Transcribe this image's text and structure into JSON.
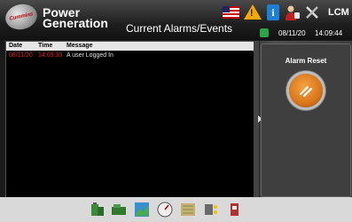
{
  "header": {
    "brand_line1": "Power",
    "brand_line2": "Generation",
    "logo_text": "Cummins",
    "page_title": "Current Alarms/Events",
    "device": "LCM",
    "date": "08/11/20",
    "time": "14:09:44"
  },
  "top_icons": [
    "us-flag-icon",
    "warning-icon",
    "info-icon",
    "user-icon",
    "tools-icon"
  ],
  "log": {
    "columns": [
      "Date",
      "Time",
      "Message"
    ],
    "rows": [
      {
        "date": "08/11/20",
        "time": "14:09:30",
        "message": "A user Logged In"
      }
    ]
  },
  "panel": {
    "reset_label": "Alarm Reset"
  },
  "colors": {
    "reset_orange": "#d9761a",
    "row_date_red": "#e02020",
    "status_green": "#2aa64a"
  },
  "toolbar_icons": [
    "battery-icon",
    "generator-icon",
    "trend-chart-icon",
    "gauge-icon",
    "map-icon",
    "io-icon",
    "switch-icon"
  ]
}
